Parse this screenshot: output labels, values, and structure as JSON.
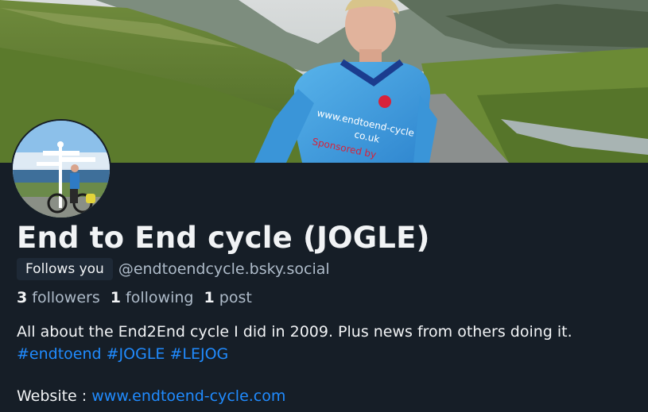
{
  "profile": {
    "banner_icon": "mountain-landscape-cyclist-photo",
    "avatar_icon": "cyclist-signpost-photo",
    "display_name": "End to End cycle (JOGLE)",
    "follows_you": "Follows you",
    "handle": "@endtoendcycle.bsky.social",
    "stats": {
      "followers_count": "3",
      "followers_label": "followers",
      "following_count": "1",
      "following_label": "following",
      "posts_count": "1",
      "posts_label": "post"
    },
    "bio": {
      "text": "All about the End2End cycle I did in 2009. Plus news from others doing it.",
      "hashtags": [
        "#endtoend",
        "#JOGLE",
        "#LEJOG"
      ],
      "website_label": "Website :",
      "website_link": "www.endtoend-cycle.com"
    }
  },
  "colors": {
    "background": "#161e27",
    "text": "#f1f3f5",
    "muted": "#aebbc9",
    "link": "#208bfe",
    "badge": "#1e2936"
  }
}
